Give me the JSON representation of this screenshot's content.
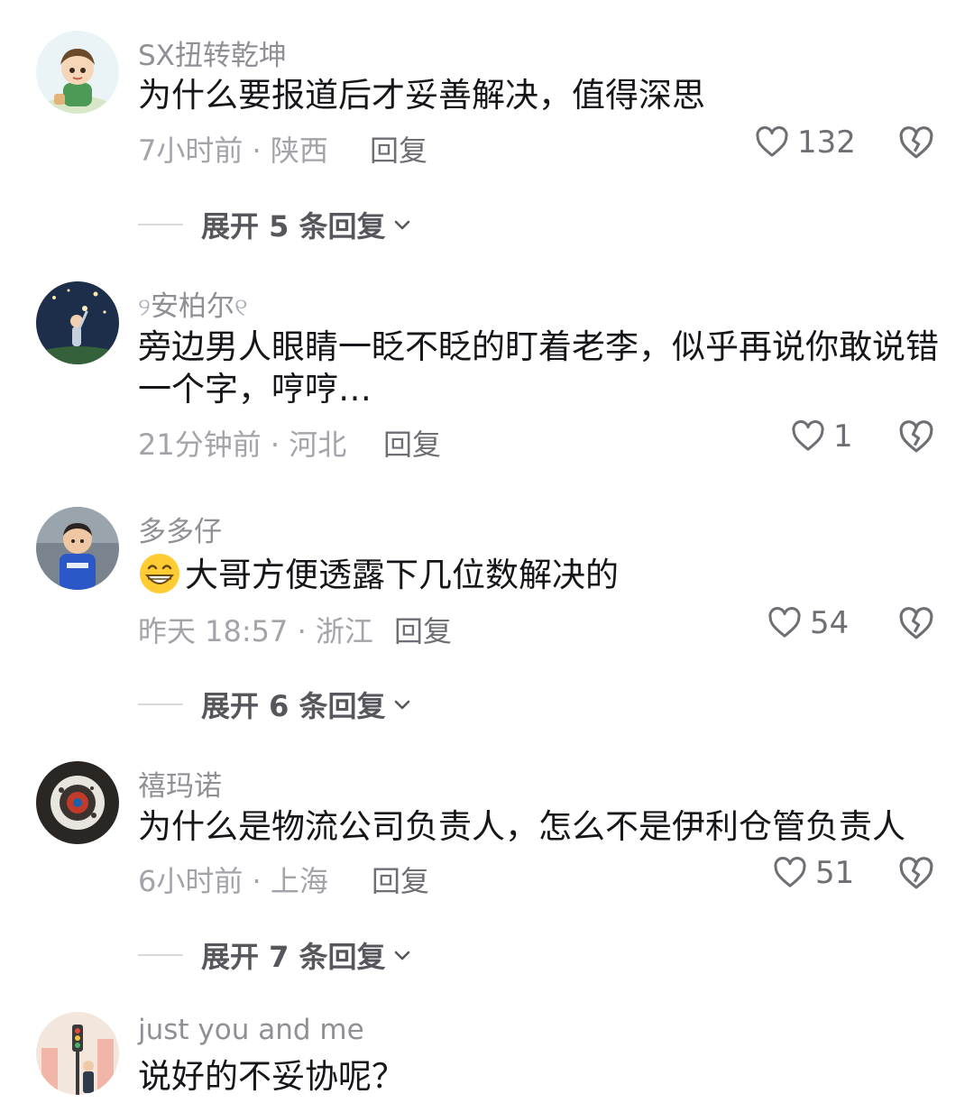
{
  "comments": [
    {
      "username": "SX扭转乾坤",
      "text": "为什么要报道后才妥善解决，值得深思",
      "time_location": "7小时前 · 陕西",
      "reply_label": "回复",
      "likes": "132",
      "expand_label": "展开 5 条回复"
    },
    {
      "username": "安柏尔",
      "text": "旁边男人眼睛一眨不眨的盯着老李，似乎再说你敢说错一个字，哼哼…",
      "time_location": "21分钟前 · 河北",
      "reply_label": "回复",
      "likes": "1"
    },
    {
      "username": "多多仔",
      "text": "大哥方便透露下几位数解决的",
      "time_location": "昨天 18:57 · 浙江",
      "reply_label": "回复",
      "likes": "54",
      "expand_label": "展开 6 条回复"
    },
    {
      "username": "禧玛诺",
      "text": "为什么是物流公司负责人，怎么不是伊利仓管负责人",
      "time_location": "6小时前 · 上海",
      "reply_label": "回复",
      "likes": "51",
      "expand_label": "展开 7 条回复"
    },
    {
      "username": "just you and me",
      "text": "说好的不妥协呢？"
    }
  ],
  "icons": {
    "like": "heart-outline-icon",
    "dislike": "broken-heart-icon",
    "expand": "chevron-down-icon",
    "emoji": "grinning-face-emoji"
  },
  "colors": {
    "text": "#16161a",
    "username": "#8f8f95",
    "meta": "#a3a3a9",
    "icon": "#6e6e74"
  }
}
